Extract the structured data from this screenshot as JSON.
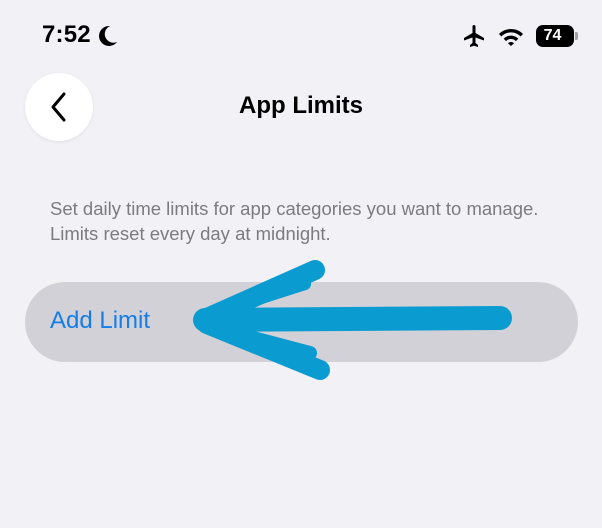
{
  "status_bar": {
    "time": "7:52",
    "focus_icon": "moon-icon",
    "airplane_icon": "airplane-icon",
    "wifi_icon": "wifi-icon",
    "battery_level": "74"
  },
  "nav": {
    "back_icon": "chevron-left-icon",
    "title": "App Limits"
  },
  "main": {
    "description": "Set daily time limits for app categories you want to manage. Limits reset every day at midnight.",
    "add_limit_label": "Add Limit"
  },
  "colors": {
    "background": "#f2f1f6",
    "accent": "#147ee8",
    "row_highlight": "#d2d1d7",
    "annotation": "#0a9bd0"
  }
}
